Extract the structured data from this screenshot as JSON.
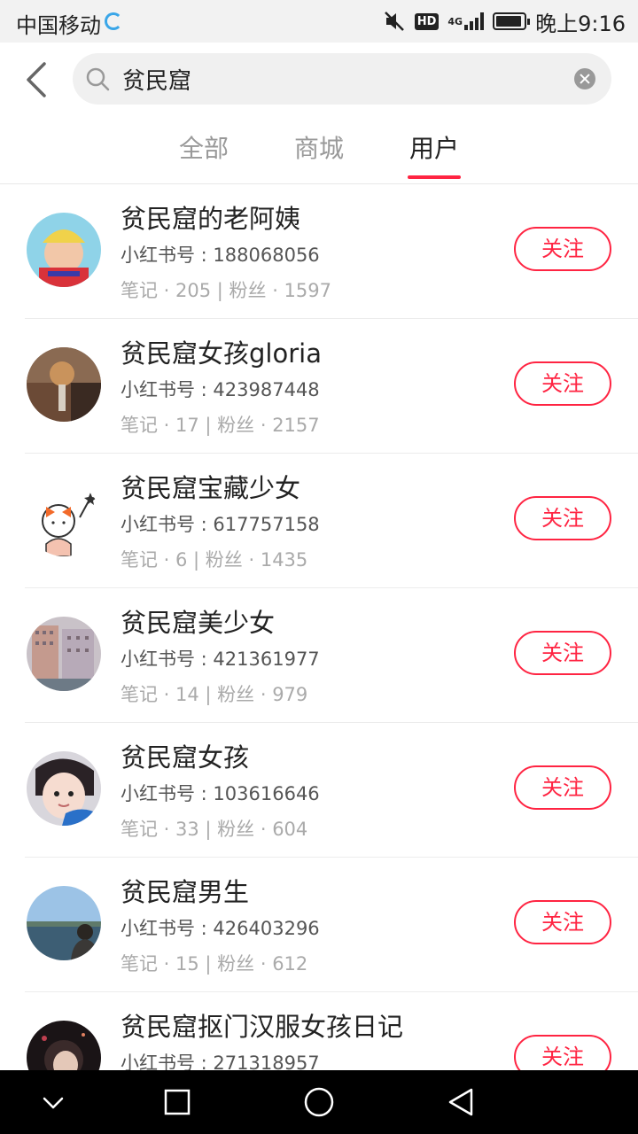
{
  "status_bar": {
    "carrier": "中国移动",
    "hd": "HD",
    "network": "4G",
    "time": "晚上9:16"
  },
  "search": {
    "query": "贫民窟"
  },
  "tabs": [
    {
      "label": "全部"
    },
    {
      "label": "商城"
    },
    {
      "label": "用户",
      "active": true
    }
  ],
  "users": [
    {
      "name": "贫民窟的老阿姨",
      "id": "小红书号 : 188068056",
      "stats": "笔记 · 205 | 粉丝 · 1597",
      "follow": "关注"
    },
    {
      "name": "贫民窟女孩gloria",
      "id": "小红书号 : 423987448",
      "stats": "笔记 · 17 | 粉丝 · 2157",
      "follow": "关注"
    },
    {
      "name": "贫民窟宝藏少女",
      "id": "小红书号 : 617757158",
      "stats": "笔记 · 6 | 粉丝 · 1435",
      "follow": "关注"
    },
    {
      "name": "贫民窟美少女",
      "id": "小红书号 : 421361977",
      "stats": "笔记 · 14 | 粉丝 · 979",
      "follow": "关注"
    },
    {
      "name": "贫民窟女孩",
      "id": "小红书号 : 103616646",
      "stats": "笔记 · 33 | 粉丝 · 604",
      "follow": "关注"
    },
    {
      "name": "贫民窟男生",
      "id": "小红书号 : 426403296",
      "stats": "笔记 · 15 | 粉丝 · 612",
      "follow": "关注"
    },
    {
      "name": "贫民窟抠门汉服女孩日记",
      "id": "小红书号 : 271318957",
      "stats": "",
      "follow": "关注"
    }
  ],
  "colors": {
    "accent": "#ff2442",
    "status_bar_bg": "#f2f2f2",
    "nav_bar_bg": "#000000"
  }
}
